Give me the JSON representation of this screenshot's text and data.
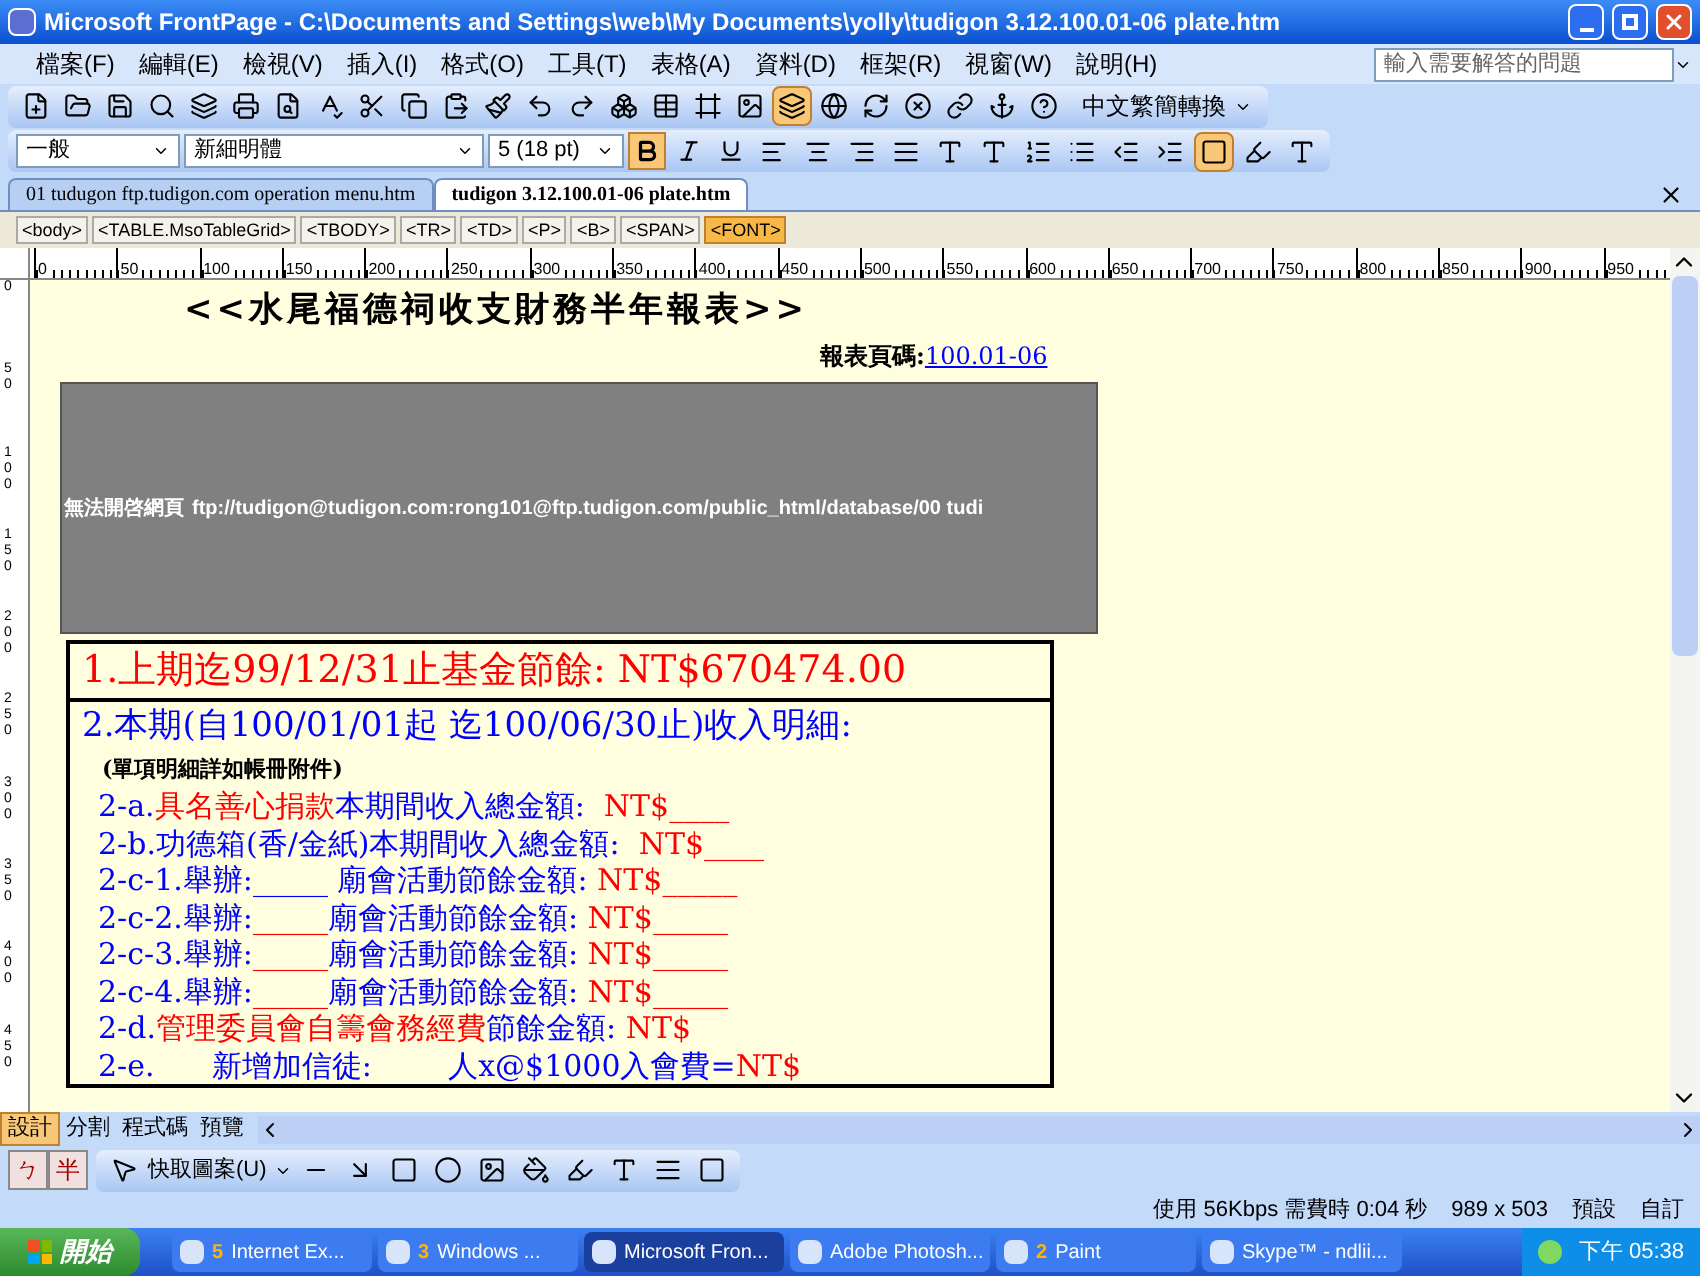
{
  "window": {
    "title": "Microsoft FrontPage - C:\\Documents and Settings\\web\\My Documents\\yolly\\tudigon 3.12.100.01-06 plate.htm"
  },
  "menu": [
    "檔案(F)",
    "編輯(E)",
    "檢視(V)",
    "插入(I)",
    "格式(O)",
    "工具(T)",
    "表格(A)",
    "資料(D)",
    "框架(R)",
    "視窗(W)",
    "說明(H)"
  ],
  "help_search": {
    "placeholder": "輸入需要解答的問題"
  },
  "standard_toolbar": {
    "convert_button": "中文繁簡轉換"
  },
  "format_toolbar": {
    "style": "一般",
    "font": "新細明體",
    "size": "5 (18 pt)",
    "bold": true,
    "italic": false,
    "underline": false
  },
  "doc_tabs": [
    {
      "label": "01 tudugon ftp.tudigon.com operation menu.htm",
      "selected": false
    },
    {
      "label": "tudigon 3.12.100.01-06 plate.htm",
      "selected": true
    }
  ],
  "tags": [
    {
      "label": "<body>",
      "selected": false
    },
    {
      "label": "<TABLE.MsoTableGrid>",
      "selected": false
    },
    {
      "label": "<TBODY>",
      "selected": false
    },
    {
      "label": "<TR>",
      "selected": false
    },
    {
      "label": "<TD>",
      "selected": false
    },
    {
      "label": "<P>",
      "selected": false
    },
    {
      "label": "<B>",
      "selected": false
    },
    {
      "label": "<SPAN>",
      "selected": false
    },
    {
      "label": "<FONT>",
      "selected": true
    }
  ],
  "ruler": [
    "0",
    "50",
    "100",
    "150",
    "200",
    "250",
    "300",
    "350",
    "400",
    "450",
    "500",
    "550",
    "600",
    "650",
    "700",
    "750",
    "800",
    "850",
    "900",
    "950"
  ],
  "vruler": [
    "0",
    "50",
    "100",
    "150",
    "200",
    "250",
    "300",
    "350",
    "400",
    "450"
  ],
  "page": {
    "heading": "<<水尾福德祠收支財務半年報表>>",
    "code_label": "報表頁碼:",
    "code_link": "100.01-06",
    "error_label": "無法開啓網頁",
    "error_url": "ftp://tudigon@tudigon.com:rong101@ftp.tudigon.com/public_html/database/00 tudi",
    "row1": "1.上期迄99/12/31止基金節餘: NT$670474.00",
    "row2_title": "2.本期(自100/01/01起 迄100/06/30止)收入明細:",
    "note": "(單項明細詳如帳冊附件)",
    "lines": [
      [
        {
          "text": "2-a.",
          "color": "#0000ff"
        },
        {
          "text": "具名善心捐款",
          "color": "#ff0000"
        },
        {
          "text": "本期間收入總金額:  ",
          "color": "#0000ff"
        },
        {
          "text": "NT$____",
          "color": "#ff0000"
        }
      ],
      [
        {
          "text": "2-b.功德箱(香/金紙)本期間收入總金額:  ",
          "color": "#0000ff"
        },
        {
          "text": "NT$____",
          "color": "#ff0000"
        }
      ],
      [
        {
          "text": "2-c-1.舉辦:_____ 廟會活動節餘金額: ",
          "color": "#0000ff"
        },
        {
          "text": "NT$_____",
          "color": "#ff0000"
        }
      ],
      [
        {
          "text": "2-c-2.舉辦:",
          "color": "#0000ff"
        },
        {
          "text": "_____",
          "color": "#ff0000"
        },
        {
          "text": "廟會活動節餘金額: ",
          "color": "#0000ff"
        },
        {
          "text": "NT$_____",
          "color": "#ff0000"
        }
      ],
      [
        {
          "text": "2-c-3.舉辦:",
          "color": "#0000ff"
        },
        {
          "text": "_____",
          "color": "#ff0000"
        },
        {
          "text": "廟會活動節餘金額: ",
          "color": "#0000ff"
        },
        {
          "text": "NT$_____",
          "color": "#ff0000"
        }
      ],
      [
        {
          "text": "2-c-4.舉辦:",
          "color": "#0000ff"
        },
        {
          "text": "_____",
          "color": "#ff0000"
        },
        {
          "text": "廟會活動節餘金額: ",
          "color": "#0000ff"
        },
        {
          "text": "NT$_____",
          "color": "#ff0000"
        }
      ],
      [
        {
          "text": "2-d.",
          "color": "#0000ff"
        },
        {
          "text": "管理委員會自籌會務經費",
          "color": "#ff0000"
        },
        {
          "text": "節餘金額: ",
          "color": "#0000ff"
        },
        {
          "text": "NT$",
          "color": "#ff0000"
        }
      ],
      [
        {
          "text": "2-e.      新增加信徒:        人x@$1000入會費=",
          "color": "#0000ff"
        },
        {
          "text": "NT$",
          "color": "#ff0000"
        }
      ]
    ]
  },
  "view_tabs": [
    {
      "label": "設計",
      "selected": true
    },
    {
      "label": "分割",
      "selected": false
    },
    {
      "label": "程式碼",
      "selected": false
    },
    {
      "label": "預覽",
      "selected": false
    }
  ],
  "drawing_toolbar": {
    "autoshapes": "快取圖案(U)"
  },
  "ime": [
    "ㄅ",
    "半"
  ],
  "status_bar": [
    "使用 56Kbps 需費時 0:04 秒",
    "989 x 503",
    "預設",
    "自訂"
  ],
  "taskbar": {
    "start": "開始",
    "tasks": [
      {
        "count": "5",
        "label": "Internet Ex...",
        "selected": false
      },
      {
        "count": "3",
        "label": "Windows ...",
        "selected": false
      },
      {
        "label": "Microsoft Fron...",
        "selected": true
      },
      {
        "label": "Adobe Photosh...",
        "selected": false
      },
      {
        "count": "2",
        "label": "Paint",
        "selected": false
      },
      {
        "label": "Skype™ - ndlii...",
        "selected": false
      }
    ],
    "clock": "下午 05:38"
  }
}
